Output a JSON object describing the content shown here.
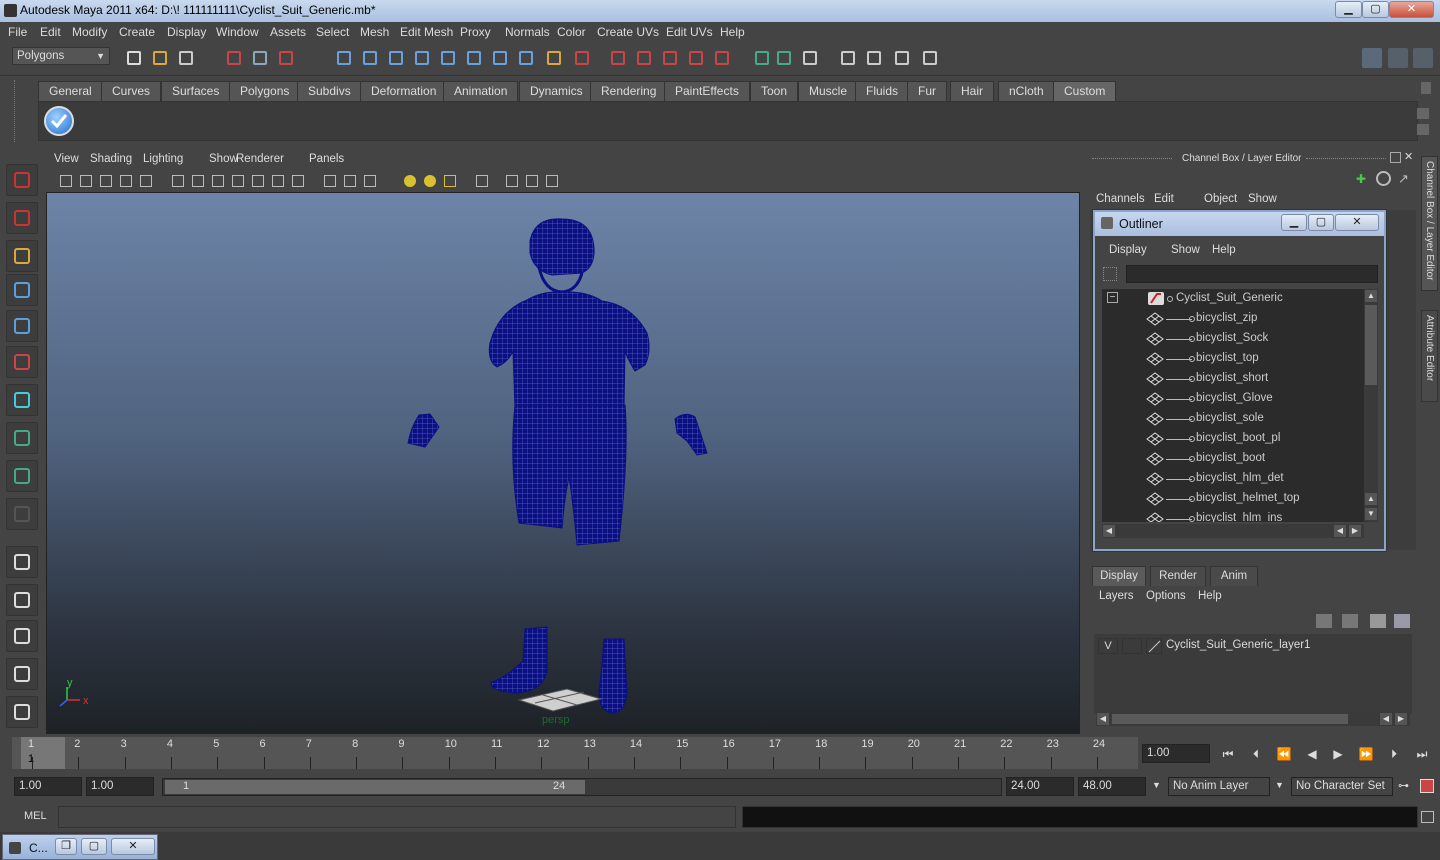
{
  "window": {
    "title": "Autodesk Maya 2011 x64: D:\\! 111111111\\Cyclist_Suit_Generic.mb*",
    "minimize": "▁",
    "maximize": "▢",
    "close": "✕"
  },
  "menubar": [
    "File",
    "Edit",
    "Modify",
    "Create",
    "Display",
    "Window",
    "Assets",
    "Select",
    "Mesh",
    "Edit Mesh",
    "Proxy",
    "Normals",
    "Color",
    "Create UVs",
    "Edit UVs",
    "Help"
  ],
  "statusline": {
    "mode_select": "Polygons"
  },
  "shelf": {
    "tabs": [
      "General",
      "Curves",
      "Surfaces",
      "Polygons",
      "Subdivs",
      "Deformation",
      "Animation",
      "Dynamics",
      "Rendering",
      "PaintEffects",
      "Toon",
      "Muscle",
      "Fluids",
      "Fur",
      "Hair",
      "nCloth",
      "Custom"
    ],
    "active": "Custom"
  },
  "viewport": {
    "menu": [
      "View",
      "Shading",
      "Lighting",
      "Show",
      "Renderer",
      "Panels"
    ],
    "camera_label": "persp",
    "axis_y": "y",
    "axis_x": "x",
    "wire_color": "#0b0f82"
  },
  "channelbox": {
    "title": "Channel Box / Layer Editor",
    "menu": [
      "Channels",
      "Edit",
      "Object",
      "Show"
    ],
    "vertical_tabs": [
      "Channel Box / Layer Editor",
      "Attribute Editor"
    ]
  },
  "outliner": {
    "title": "Outliner",
    "menu": [
      "Display",
      "Show",
      "Help"
    ],
    "search_value": "",
    "root": "Cyclist_Suit_Generic",
    "root_expand": "−",
    "items": [
      "bicyclist_zip",
      "bicyclist_Sock",
      "bicyclist_top",
      "bicyclist_short",
      "bicyclist_Glove",
      "bicyclist_sole",
      "bicyclist_boot_pl",
      "bicyclist_boot",
      "bicyclist_hlm_det",
      "bicyclist_helmet_top",
      "bicyclist_hlm_ins"
    ]
  },
  "layer_editor": {
    "tabs": [
      "Display",
      "Render",
      "Anim"
    ],
    "active_tab": "Display",
    "menu": [
      "Layers",
      "Options",
      "Help"
    ],
    "layer": {
      "visible": "V",
      "name": "Cyclist_Suit_Generic_layer1"
    }
  },
  "timeline": {
    "ticks": [
      "1",
      "2",
      "3",
      "4",
      "5",
      "6",
      "7",
      "8",
      "9",
      "10",
      "11",
      "12",
      "13",
      "14",
      "15",
      "16",
      "17",
      "18",
      "19",
      "20",
      "21",
      "22",
      "23",
      "24"
    ],
    "current_frame_marker": "1",
    "current_time": "1.00"
  },
  "range": {
    "start": "1.00",
    "playback_start": "1.00",
    "slider_start": "1",
    "slider_end": "24",
    "playback_end": "24.00",
    "end": "48.00",
    "anim_layer": "No Anim Layer",
    "character_set": "No Character Set"
  },
  "cmdline": {
    "label": "MEL",
    "value": ""
  },
  "taskbar": {
    "item": "C..."
  }
}
